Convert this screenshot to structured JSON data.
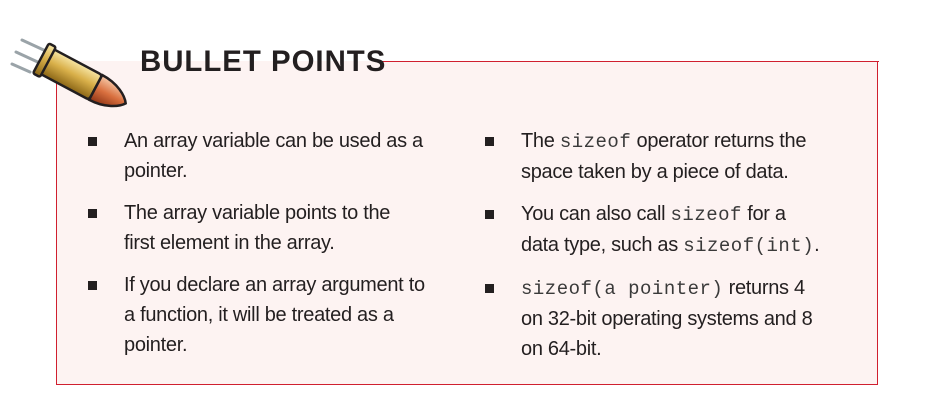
{
  "heading": {
    "title": "BULLET POINTS",
    "icon": "bullet-cartridge-icon"
  },
  "colors": {
    "accent": "#d01f2f",
    "box_bg": "#fdf3f2",
    "text": "#231f20"
  },
  "left_points": [
    {
      "text": "An array variable can be used as a pointer."
    },
    {
      "text": "The array variable points to the first element in the array."
    },
    {
      "text": "If you declare an array argument to a function, it will be treated as a pointer."
    }
  ],
  "right_points": [
    {
      "pre": "The ",
      "code": "sizeof",
      "post": " operator returns the space taken by a piece of data."
    },
    {
      "pre": "You can also call ",
      "code": "sizeof",
      "mid": " for a data type, such as ",
      "code2": "sizeof(int)",
      "post": "."
    },
    {
      "code": "sizeof(a pointer)",
      "post": " returns 4 on 32-bit operating systems and 8 on 64-bit."
    }
  ]
}
